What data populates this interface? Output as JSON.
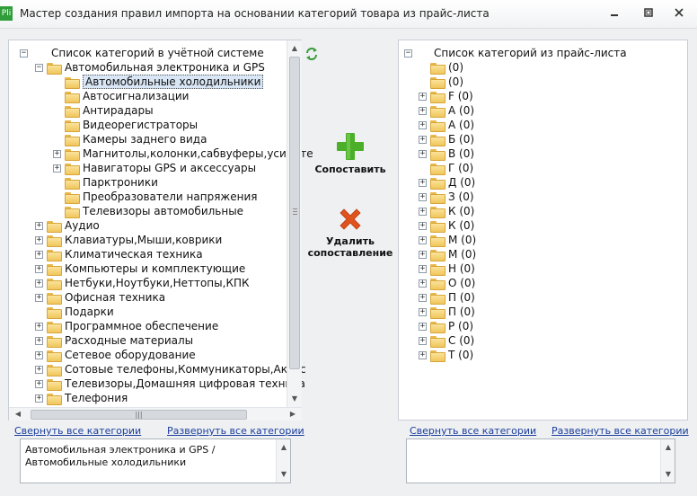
{
  "window": {
    "app_icon_text": "Pli",
    "title": "Мастер создания правил импорта на основании категорий товара из прайс-листа",
    "controls": {
      "minimize": "▭",
      "maximize": "◻",
      "close": "✕"
    }
  },
  "left_tree": {
    "root_label": "Список категорий в учётной системе",
    "nodes": [
      {
        "label": "Автомобильная электроника и GPS",
        "expander": "−"
      },
      {
        "label": "Автомобильные холодильники",
        "expander": "",
        "selected": true
      },
      {
        "label": "Автосигнализации",
        "expander": ""
      },
      {
        "label": "Антирадары",
        "expander": ""
      },
      {
        "label": "Видеорегистраторы",
        "expander": ""
      },
      {
        "label": "Камеры заднего вида",
        "expander": ""
      },
      {
        "label": "Магнитолы,колонки,сабвуферы,усилите",
        "expander": "+"
      },
      {
        "label": "Навигаторы GPS и аксессуары",
        "expander": "+"
      },
      {
        "label": "Парктроники",
        "expander": ""
      },
      {
        "label": "Преобразователи напряжения",
        "expander": ""
      },
      {
        "label": "Телевизоры автомобильные",
        "expander": ""
      },
      {
        "label": "Аудио",
        "expander": "+"
      },
      {
        "label": "Клавиатуры,Мыши,коврики",
        "expander": "+"
      },
      {
        "label": "Климатическая техника",
        "expander": "+"
      },
      {
        "label": "Компьютеры и комплектующие",
        "expander": "+"
      },
      {
        "label": "Нетбуки,Ноутбуки,Неттопы,КПК",
        "expander": "+"
      },
      {
        "label": "Офисная техника",
        "expander": "+"
      },
      {
        "label": "Подарки",
        "expander": ""
      },
      {
        "label": "Программное обеспечение",
        "expander": "+"
      },
      {
        "label": "Расходные материалы",
        "expander": "+"
      },
      {
        "label": "Сетевое оборудование",
        "expander": "+"
      },
      {
        "label": "Сотовые телефоны,Коммуникаторы,Аксес",
        "expander": "+"
      },
      {
        "label": "Телевизоры,Домашняя цифровая техника",
        "expander": "+"
      },
      {
        "label": "Телефония",
        "expander": "+"
      }
    ],
    "collapse_all": "Свернуть все категории",
    "expand_all": "Развернуть все категории",
    "path_text": "Автомобильная электроника и GPS / Автомобильные холодильники"
  },
  "actions": {
    "match_label": "Сопоставить",
    "delete_label_line1": "Удалить",
    "delete_label_line2": "сопоставление"
  },
  "right_tree": {
    "root_label": "Список категорий из прайс-листа",
    "nodes": [
      {
        "label": " (0)",
        "expander": ""
      },
      {
        "label": " (0)",
        "expander": ""
      },
      {
        "label": "F (0)",
        "expander": "+"
      },
      {
        "label": "А (0)",
        "expander": "+"
      },
      {
        "label": "А (0)",
        "expander": "+"
      },
      {
        "label": "Б (0)",
        "expander": "+"
      },
      {
        "label": "В (0)",
        "expander": "+"
      },
      {
        "label": "Г (0)",
        "expander": ""
      },
      {
        "label": "Д (0)",
        "expander": "+"
      },
      {
        "label": "З (0)",
        "expander": "+"
      },
      {
        "label": "К (0)",
        "expander": "+"
      },
      {
        "label": "К (0)",
        "expander": "+"
      },
      {
        "label": "М (0)",
        "expander": "+"
      },
      {
        "label": "М (0)",
        "expander": "+"
      },
      {
        "label": "Н (0)",
        "expander": "+"
      },
      {
        "label": "О (0)",
        "expander": "+"
      },
      {
        "label": "П (0)",
        "expander": "+"
      },
      {
        "label": "П (0)",
        "expander": "+"
      },
      {
        "label": "Р (0)",
        "expander": "+"
      },
      {
        "label": "С (0)",
        "expander": "+"
      },
      {
        "label": "Т (0)",
        "expander": "+"
      }
    ],
    "collapse_all": "Свернуть все категории",
    "expand_all": "Развернуть все категории",
    "path_text": ""
  },
  "colors": {
    "link": "#1a3d9c",
    "match_icon": "#4caf2a",
    "delete_icon": "#e0531c",
    "refresh_icon": "#3a9a3a"
  }
}
